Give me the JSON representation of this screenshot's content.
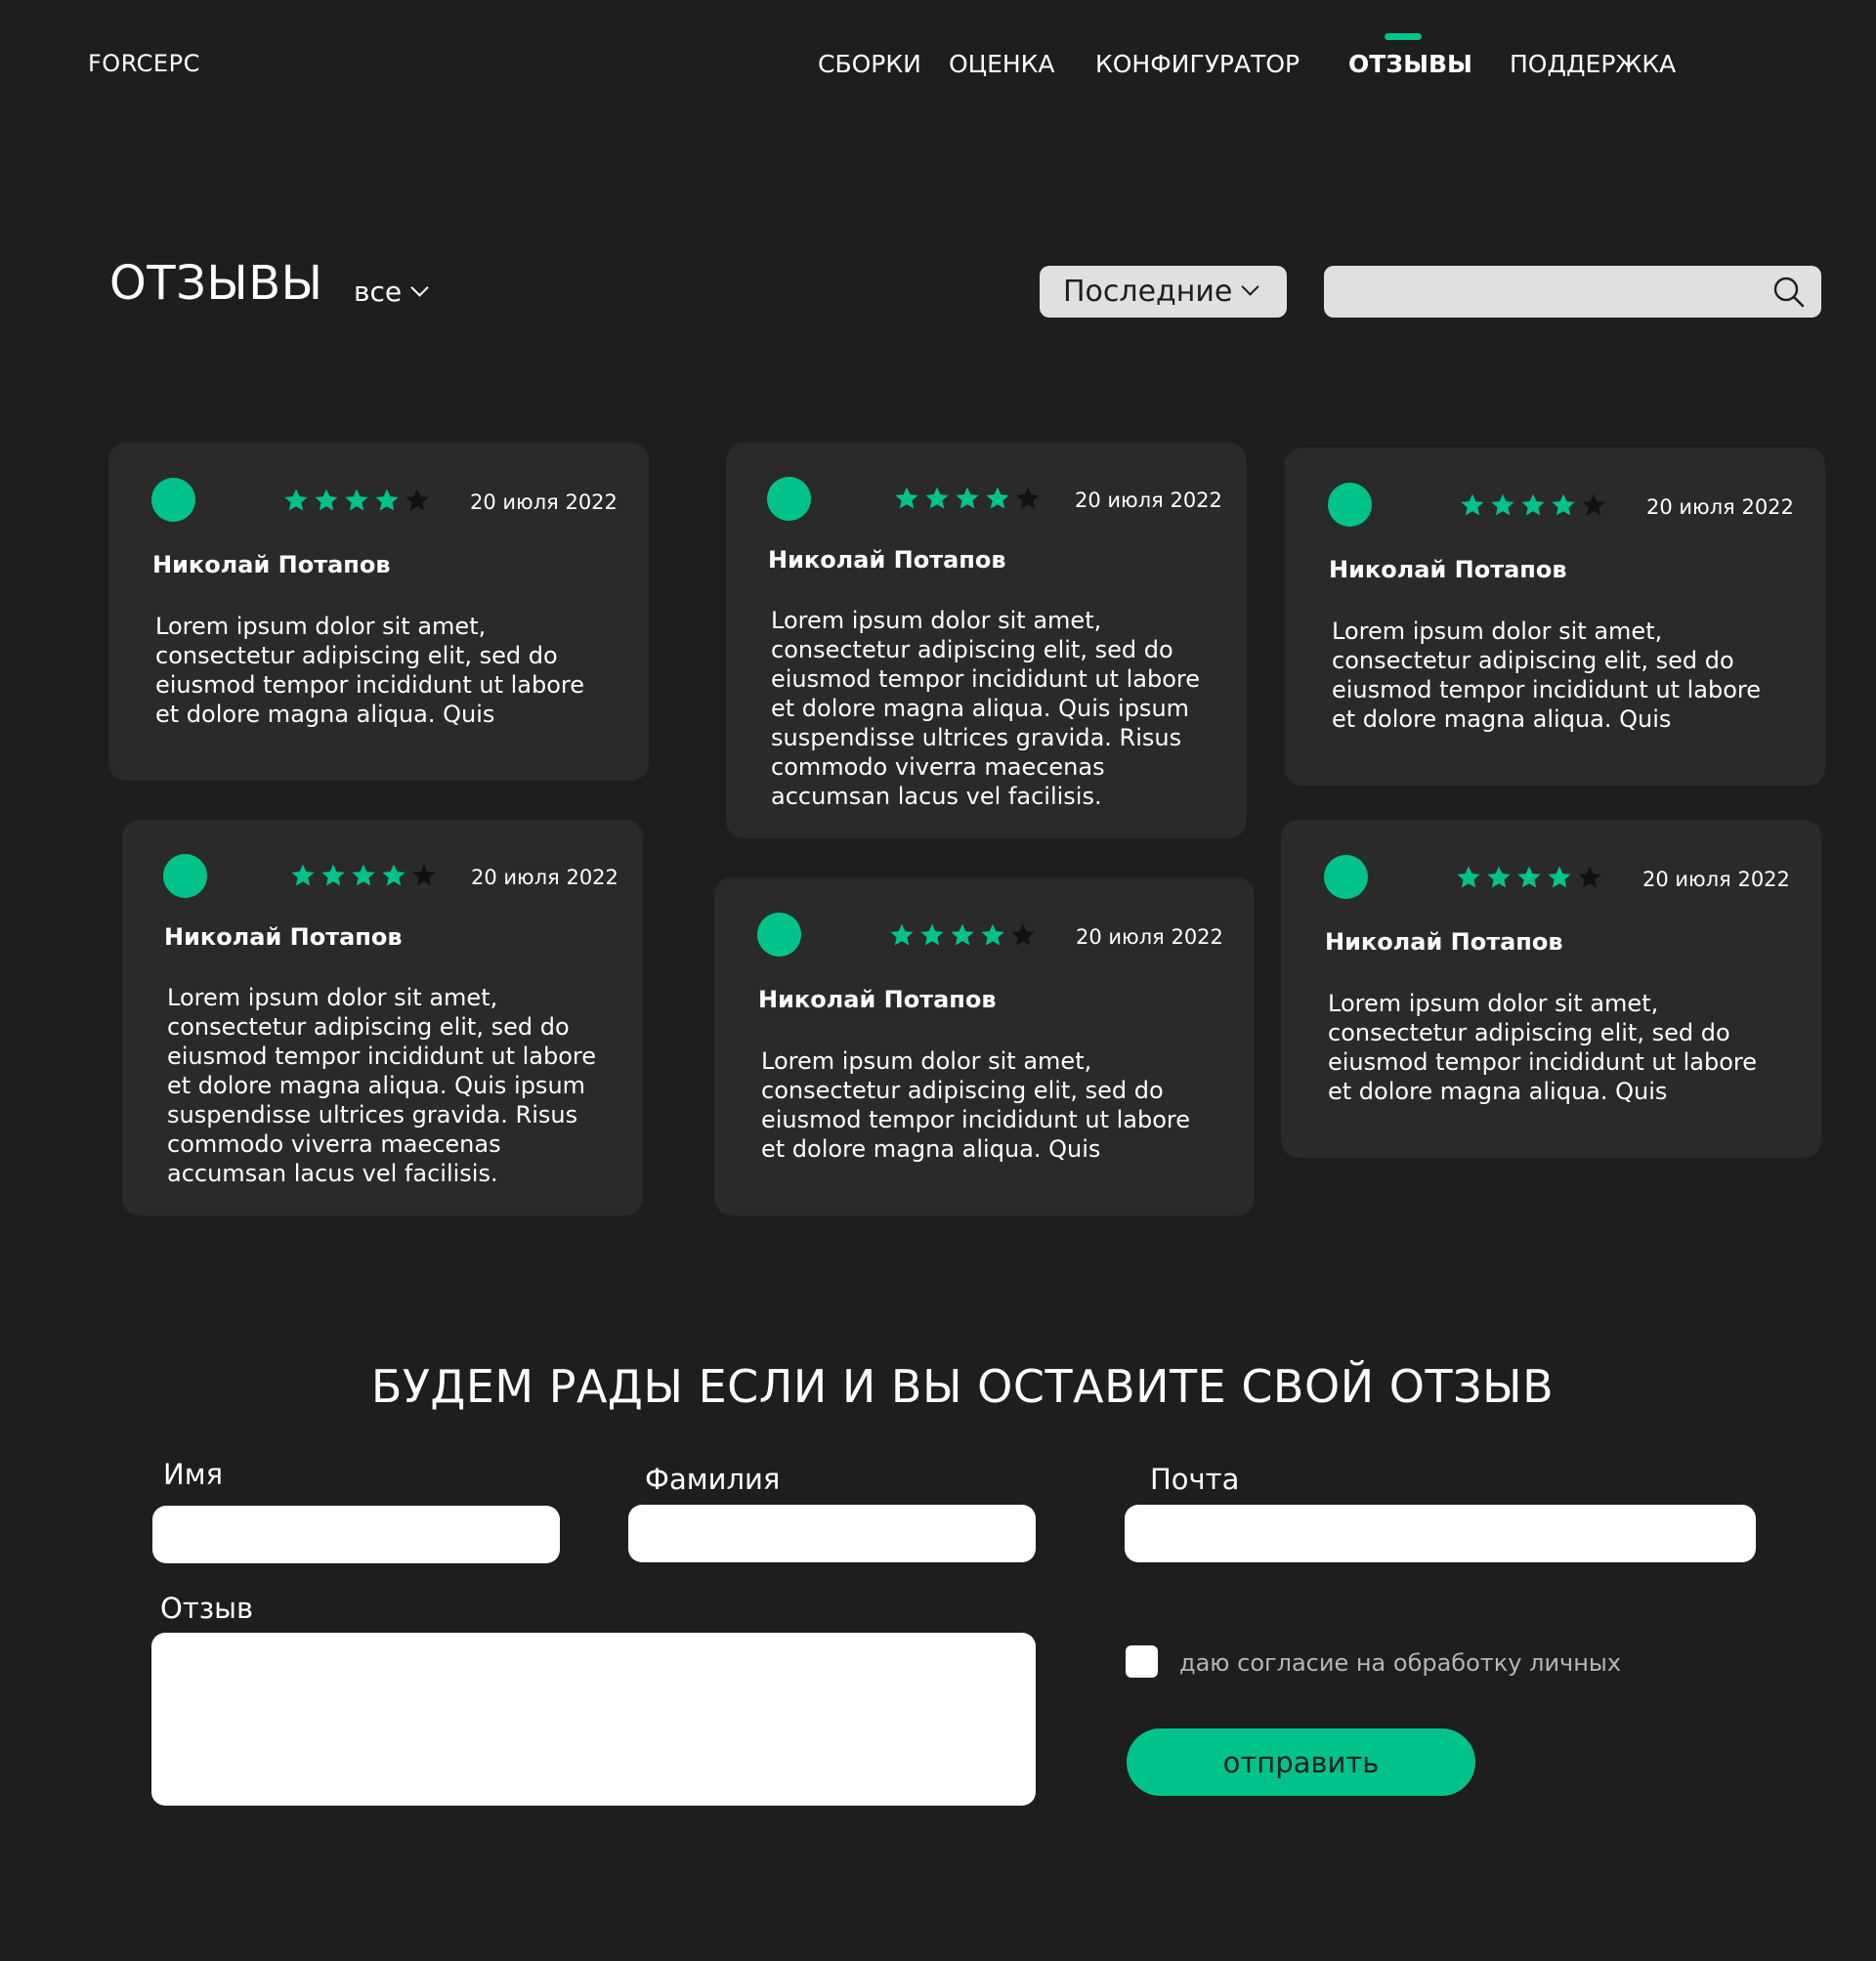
{
  "header": {
    "logo": "FORCEPC",
    "nav": [
      {
        "label": "СБОРКИ"
      },
      {
        "label": "ОЦЕНКА"
      },
      {
        "label": "КОНФИГУРАТОР"
      },
      {
        "label": "ОТЗЫВЫ",
        "active": true
      },
      {
        "label": "ПОДДЕРЖКА"
      }
    ]
  },
  "reviews_header": {
    "title": "ОТЗЫВЫ",
    "filter": "все",
    "sort": "Последние",
    "search_placeholder": ""
  },
  "reviews": [
    {
      "name": "Николай Потапов",
      "date": "20 июля 2022",
      "rating": 4,
      "max_rating": 5,
      "text": "Lorem ipsum dolor sit amet, consectetur adipiscing elit, sed do eiusmod tempor incididunt ut labore et dolore magna aliqua. Quis"
    },
    {
      "name": "Николай Потапов",
      "date": "20 июля 2022",
      "rating": 4,
      "max_rating": 5,
      "text": "Lorem ipsum dolor sit amet, consectetur adipiscing elit, sed do eiusmod tempor incididunt ut labore et dolore magna aliqua. Quis ipsum suspendisse ultrices gravida. Risus commodo viverra maecenas accumsan lacus vel facilisis."
    },
    {
      "name": "Николай Потапов",
      "date": "20 июля 2022",
      "rating": 4,
      "max_rating": 5,
      "text": "Lorem ipsum dolor sit amet, consectetur adipiscing elit, sed do eiusmod tempor incididunt ut labore et dolore magna aliqua. Quis"
    },
    {
      "name": "Николай Потапов",
      "date": "20 июля 2022",
      "rating": 4,
      "max_rating": 5,
      "text": "Lorem ipsum dolor sit amet, consectetur adipiscing elit, sed do eiusmod tempor incididunt ut labore et dolore magna aliqua. Quis ipsum suspendisse ultrices gravida. Risus commodo viverra maecenas accumsan lacus vel facilisis."
    },
    {
      "name": "Николай Потапов",
      "date": "20 июля 2022",
      "rating": 4,
      "max_rating": 5,
      "text": "Lorem ipsum dolor sit amet, consectetur adipiscing elit, sed do eiusmod tempor incididunt ut labore et dolore magna aliqua. Quis"
    },
    {
      "name": "Николай Потапов",
      "date": "20 июля 2022",
      "rating": 4,
      "max_rating": 5,
      "text": "Lorem ipsum dolor sit amet, consectetur adipiscing elit, sed do eiusmod tempor incididunt ut labore et dolore magna aliqua. Quis"
    }
  ],
  "form": {
    "title": "БУДЕМ РАДЫ ЕСЛИ И ВЫ ОСТАВИТЕ СВОЙ ОТЗЫВ",
    "first_name_label": "Имя",
    "last_name_label": "Фамилия",
    "email_label": "Почта",
    "review_label": "Отзыв",
    "consent_text": "даю согласие на обработку личных",
    "submit_label": "отправить"
  },
  "colors": {
    "background": "#1e1e1e",
    "card": "#2a2a2a",
    "accent": "#00c389",
    "star_empty": "#111111"
  },
  "icons": {
    "search": "search-icon",
    "dropdown": "chevron-down-icon",
    "star": "star-icon",
    "avatar": "avatar"
  }
}
